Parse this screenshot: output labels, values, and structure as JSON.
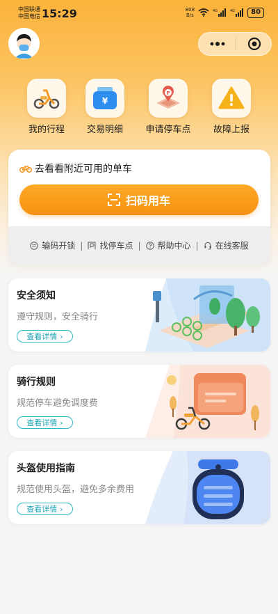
{
  "status_bar": {
    "carrier_1": "中国联通",
    "carrier_2": "中国电信",
    "time": "15:29",
    "net_speed_value": "808",
    "net_speed_unit": "B/s",
    "battery": "80"
  },
  "capsule": {
    "more_icon": "more-dots-icon",
    "close_icon": "target-icon"
  },
  "quick_actions": [
    {
      "label": "我的行程",
      "icon": "scooter-icon"
    },
    {
      "label": "交易明细",
      "icon": "wallet-icon"
    },
    {
      "label": "申请停车点",
      "icon": "parking-map-icon"
    },
    {
      "label": "故障上报",
      "icon": "warning-icon"
    }
  ],
  "ride_card": {
    "nearby_text": "去看看附近可用的单车",
    "scan_label": "扫码用车",
    "tools": [
      {
        "label": "输码开锁",
        "icon": "keypad-icon"
      },
      {
        "label": "找停车点",
        "icon": "parking-icon"
      },
      {
        "label": "帮助中心",
        "icon": "help-icon"
      },
      {
        "label": "在线客服",
        "icon": "headset-icon"
      }
    ]
  },
  "info_cards": [
    {
      "title": "安全须知",
      "desc": "遵守规则，安全骑行",
      "button": "查看详情"
    },
    {
      "title": "骑行规则",
      "desc": "规范停车避免调度费",
      "button": "查看详情"
    },
    {
      "title": "头盔使用指南",
      "desc": "规范使用头盔，避免多余费用",
      "button": "查看详情"
    }
  ],
  "colors": {
    "accent": "#f79213",
    "link": "#1aa3b5",
    "header": "#fbb23a"
  }
}
